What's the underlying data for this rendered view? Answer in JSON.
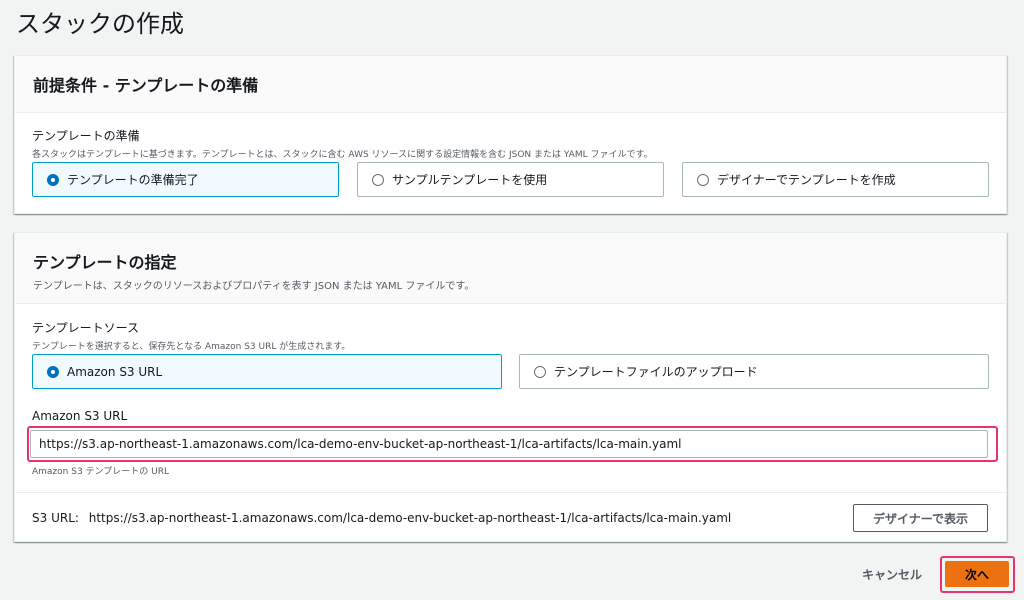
{
  "page": {
    "title": "スタックの作成"
  },
  "prerequisite": {
    "title": "前提条件 - テンプレートの準備",
    "field_label": "テンプレートの準備",
    "field_desc": "各スタックはテンプレートに基づきます。テンプレートとは、スタックに含む AWS リソースに関する設定情報を含む JSON または YAML ファイルです。",
    "options": [
      {
        "label": "テンプレートの準備完了",
        "selected": true
      },
      {
        "label": "サンプルテンプレートを使用",
        "selected": false
      },
      {
        "label": "デザイナーでテンプレートを作成",
        "selected": false
      }
    ]
  },
  "specify": {
    "title": "テンプレートの指定",
    "desc": "テンプレートは、スタックのリソースおよびプロパティを表す JSON または YAML ファイルです。",
    "source_label": "テンプレートソース",
    "source_desc": "テンプレートを選択すると、保存先となる Amazon S3 URL が生成されます。",
    "sources": [
      {
        "label": "Amazon S3 URL",
        "selected": true
      },
      {
        "label": "テンプレートファイルのアップロード",
        "selected": false
      }
    ],
    "url_label": "Amazon S3 URL",
    "url_value": "https://s3.ap-northeast-1.amazonaws.com/lca-demo-env-bucket-ap-northeast-1/lca-artifacts/lca-main.yaml",
    "url_hint": "Amazon S3 テンプレートの URL",
    "s3_url_prefix": "S3 URL:",
    "s3_url_value": "https://s3.ap-northeast-1.amazonaws.com/lca-demo-env-bucket-ap-northeast-1/lca-artifacts/lca-main.yaml",
    "designer_button": "デザイナーで表示"
  },
  "footer": {
    "cancel": "キャンセル",
    "next": "次へ"
  },
  "colors": {
    "accent": "#ec7211",
    "selected_border": "#00a1c9",
    "highlight": "#e8336e"
  }
}
